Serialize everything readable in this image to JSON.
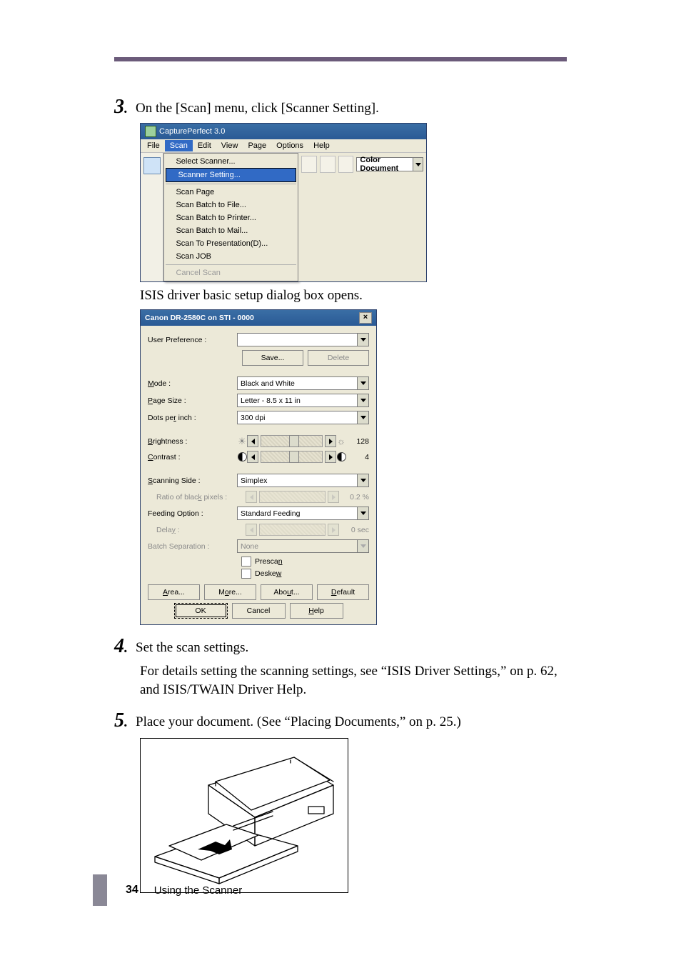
{
  "step3": {
    "num": "3",
    "text": "On the [Scan] menu, click [Scanner Setting]."
  },
  "cp": {
    "title": "CapturePerfect 3.0",
    "menu": [
      "File",
      "Scan",
      "Edit",
      "View",
      "Page",
      "Options",
      "Help"
    ],
    "menu_open_index": 1,
    "drop": {
      "select_scanner": "Select Scanner...",
      "scanner_setting": "Scanner Setting...",
      "scan_page": "Scan Page",
      "scan_batch_file": "Scan Batch to File...",
      "scan_batch_printer": "Scan Batch to Printer...",
      "scan_batch_mail": "Scan Batch to Mail...",
      "scan_to_presentation": "Scan To Presentation(D)...",
      "scan_job": "Scan JOB",
      "cancel_scan": "Cancel Scan"
    },
    "combo_value": "Color Document"
  },
  "after_cp": "ISIS driver basic setup dialog box opens.",
  "isis": {
    "title": "Canon DR-2580C on STI - 0000",
    "user_pref_label": "User Preference :",
    "save_btn": "Save...",
    "delete_btn": "Delete",
    "mode_label": "Mode :",
    "mode_value": "Black and White",
    "page_size_label": "Page Size :",
    "page_size_value": "Letter - 8.5 x 11 in",
    "dpi_label": "Dots per inch :",
    "dpi_value": "300 dpi",
    "brightness_label": "Brightness :",
    "brightness_value": "128",
    "contrast_label": "Contrast :",
    "contrast_value": "4",
    "scanning_side_label": "Scanning Side :",
    "scanning_side_value": "Simplex",
    "ratio_label": "Ratio of black pixels :",
    "ratio_value": "0.2 %",
    "feeding_label": "Feeding Option :",
    "feeding_value": "Standard Feeding",
    "delay_label": "Delay :",
    "delay_value": "0 sec",
    "batch_label": "Batch Separation :",
    "batch_value": "None",
    "prescan_label": "Prescan",
    "deskew_label": "Deskew",
    "area_btn": "Area...",
    "more_btn": "More...",
    "about_btn": "About...",
    "default_btn": "Default",
    "ok_btn": "OK",
    "cancel_btn": "Cancel",
    "help_btn": "Help"
  },
  "step4": {
    "num": "4",
    "text": "Set the scan settings.",
    "body": "For details setting the scanning settings, see “ISIS Driver Settings,” on p. 62, and ISIS/TWAIN Driver Help."
  },
  "step5": {
    "num": "5",
    "text": "Place your document. (See “Placing Documents,” on p. 25.)"
  },
  "footer": {
    "page": "34",
    "section": "Using the Scanner"
  }
}
